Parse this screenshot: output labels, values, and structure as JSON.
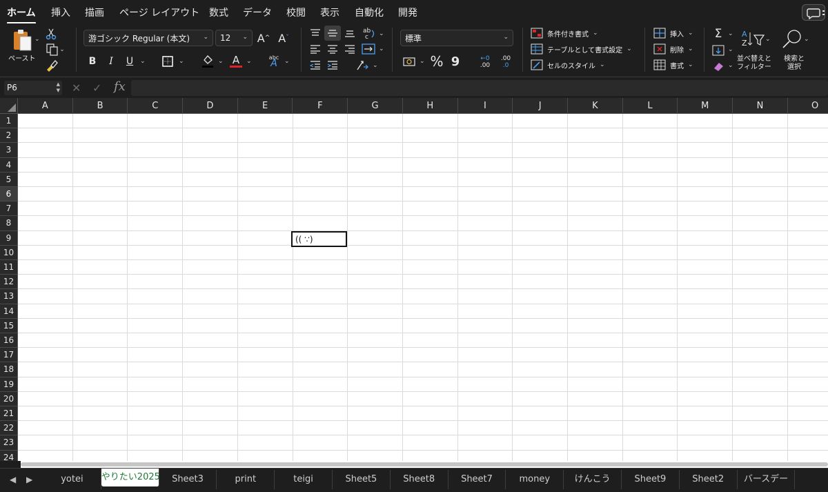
{
  "ribbon_tabs": [
    "ホーム",
    "挿入",
    "描画",
    "ページ レイアウト",
    "数式",
    "データ",
    "校閲",
    "表示",
    "自動化",
    "開発"
  ],
  "clipboard": {
    "paste_label": "ペースト"
  },
  "font": {
    "name": "游ゴシック Regular (本文)",
    "size": "12",
    "grow": "A^",
    "shrink": "Aˇ",
    "bold": "B",
    "italic": "I",
    "underline": "U",
    "font_color": "A",
    "phonetic": "abc"
  },
  "number": {
    "format": "標準",
    "percent": "%",
    "comma": "9",
    "inc_decimal": ".00",
    "dec_decimal": ".0"
  },
  "styles": {
    "conditional": "条件付き書式",
    "as_table": "テーブルとして書式設定",
    "cell_styles": "セルのスタイル"
  },
  "cells_group": {
    "insert": "挿入",
    "delete": "削除",
    "format": "書式"
  },
  "editing": {
    "sort_filter": "並べ替えと\nフィルター",
    "find_select": "検索と\n選択",
    "sum": "Σ"
  },
  "formula_bar": {
    "name_box": "P6",
    "fx": "fx",
    "value": ""
  },
  "columns": [
    "A",
    "B",
    "C",
    "D",
    "E",
    "F",
    "G",
    "H",
    "I",
    "J",
    "K",
    "L",
    "M",
    "N",
    "O"
  ],
  "rows": [
    "1",
    "2",
    "3",
    "4",
    "5",
    "6",
    "7",
    "8",
    "9",
    "10",
    "11",
    "12",
    "13",
    "14",
    "15",
    "16",
    "17",
    "18",
    "19",
    "20",
    "21",
    "22",
    "23",
    "24"
  ],
  "active_row": "6",
  "cells": {
    "F9": "((  ∵)"
  },
  "sheets": [
    "yotei",
    "やりたい2025",
    "Sheet3",
    "print",
    "teigi",
    "Sheet5",
    "Sheet8",
    "Sheet7",
    "money",
    "けんこう",
    "Sheet9",
    "Sheet2",
    "バースデー"
  ],
  "active_sheet": "やりたい2025"
}
